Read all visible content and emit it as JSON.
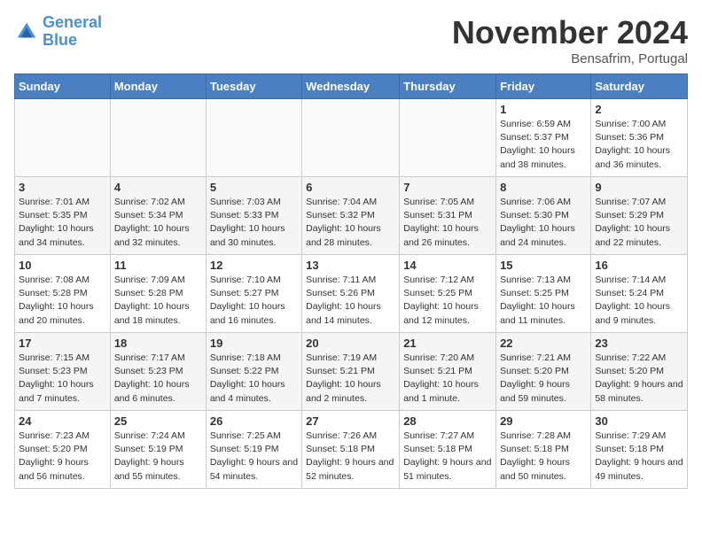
{
  "logo": {
    "line1": "General",
    "line2": "Blue"
  },
  "title": "November 2024",
  "location": "Bensafrim, Portugal",
  "headers": [
    "Sunday",
    "Monday",
    "Tuesday",
    "Wednesday",
    "Thursday",
    "Friday",
    "Saturday"
  ],
  "weeks": [
    [
      {
        "day": "",
        "sunrise": "",
        "sunset": "",
        "daylight": ""
      },
      {
        "day": "",
        "sunrise": "",
        "sunset": "",
        "daylight": ""
      },
      {
        "day": "",
        "sunrise": "",
        "sunset": "",
        "daylight": ""
      },
      {
        "day": "",
        "sunrise": "",
        "sunset": "",
        "daylight": ""
      },
      {
        "day": "",
        "sunrise": "",
        "sunset": "",
        "daylight": ""
      },
      {
        "day": "1",
        "sunrise": "Sunrise: 6:59 AM",
        "sunset": "Sunset: 5:37 PM",
        "daylight": "Daylight: 10 hours and 38 minutes."
      },
      {
        "day": "2",
        "sunrise": "Sunrise: 7:00 AM",
        "sunset": "Sunset: 5:36 PM",
        "daylight": "Daylight: 10 hours and 36 minutes."
      }
    ],
    [
      {
        "day": "3",
        "sunrise": "Sunrise: 7:01 AM",
        "sunset": "Sunset: 5:35 PM",
        "daylight": "Daylight: 10 hours and 34 minutes."
      },
      {
        "day": "4",
        "sunrise": "Sunrise: 7:02 AM",
        "sunset": "Sunset: 5:34 PM",
        "daylight": "Daylight: 10 hours and 32 minutes."
      },
      {
        "day": "5",
        "sunrise": "Sunrise: 7:03 AM",
        "sunset": "Sunset: 5:33 PM",
        "daylight": "Daylight: 10 hours and 30 minutes."
      },
      {
        "day": "6",
        "sunrise": "Sunrise: 7:04 AM",
        "sunset": "Sunset: 5:32 PM",
        "daylight": "Daylight: 10 hours and 28 minutes."
      },
      {
        "day": "7",
        "sunrise": "Sunrise: 7:05 AM",
        "sunset": "Sunset: 5:31 PM",
        "daylight": "Daylight: 10 hours and 26 minutes."
      },
      {
        "day": "8",
        "sunrise": "Sunrise: 7:06 AM",
        "sunset": "Sunset: 5:30 PM",
        "daylight": "Daylight: 10 hours and 24 minutes."
      },
      {
        "day": "9",
        "sunrise": "Sunrise: 7:07 AM",
        "sunset": "Sunset: 5:29 PM",
        "daylight": "Daylight: 10 hours and 22 minutes."
      }
    ],
    [
      {
        "day": "10",
        "sunrise": "Sunrise: 7:08 AM",
        "sunset": "Sunset: 5:28 PM",
        "daylight": "Daylight: 10 hours and 20 minutes."
      },
      {
        "day": "11",
        "sunrise": "Sunrise: 7:09 AM",
        "sunset": "Sunset: 5:28 PM",
        "daylight": "Daylight: 10 hours and 18 minutes."
      },
      {
        "day": "12",
        "sunrise": "Sunrise: 7:10 AM",
        "sunset": "Sunset: 5:27 PM",
        "daylight": "Daylight: 10 hours and 16 minutes."
      },
      {
        "day": "13",
        "sunrise": "Sunrise: 7:11 AM",
        "sunset": "Sunset: 5:26 PM",
        "daylight": "Daylight: 10 hours and 14 minutes."
      },
      {
        "day": "14",
        "sunrise": "Sunrise: 7:12 AM",
        "sunset": "Sunset: 5:25 PM",
        "daylight": "Daylight: 10 hours and 12 minutes."
      },
      {
        "day": "15",
        "sunrise": "Sunrise: 7:13 AM",
        "sunset": "Sunset: 5:25 PM",
        "daylight": "Daylight: 10 hours and 11 minutes."
      },
      {
        "day": "16",
        "sunrise": "Sunrise: 7:14 AM",
        "sunset": "Sunset: 5:24 PM",
        "daylight": "Daylight: 10 hours and 9 minutes."
      }
    ],
    [
      {
        "day": "17",
        "sunrise": "Sunrise: 7:15 AM",
        "sunset": "Sunset: 5:23 PM",
        "daylight": "Daylight: 10 hours and 7 minutes."
      },
      {
        "day": "18",
        "sunrise": "Sunrise: 7:17 AM",
        "sunset": "Sunset: 5:23 PM",
        "daylight": "Daylight: 10 hours and 6 minutes."
      },
      {
        "day": "19",
        "sunrise": "Sunrise: 7:18 AM",
        "sunset": "Sunset: 5:22 PM",
        "daylight": "Daylight: 10 hours and 4 minutes."
      },
      {
        "day": "20",
        "sunrise": "Sunrise: 7:19 AM",
        "sunset": "Sunset: 5:21 PM",
        "daylight": "Daylight: 10 hours and 2 minutes."
      },
      {
        "day": "21",
        "sunrise": "Sunrise: 7:20 AM",
        "sunset": "Sunset: 5:21 PM",
        "daylight": "Daylight: 10 hours and 1 minute."
      },
      {
        "day": "22",
        "sunrise": "Sunrise: 7:21 AM",
        "sunset": "Sunset: 5:20 PM",
        "daylight": "Daylight: 9 hours and 59 minutes."
      },
      {
        "day": "23",
        "sunrise": "Sunrise: 7:22 AM",
        "sunset": "Sunset: 5:20 PM",
        "daylight": "Daylight: 9 hours and 58 minutes."
      }
    ],
    [
      {
        "day": "24",
        "sunrise": "Sunrise: 7:23 AM",
        "sunset": "Sunset: 5:20 PM",
        "daylight": "Daylight: 9 hours and 56 minutes."
      },
      {
        "day": "25",
        "sunrise": "Sunrise: 7:24 AM",
        "sunset": "Sunset: 5:19 PM",
        "daylight": "Daylight: 9 hours and 55 minutes."
      },
      {
        "day": "26",
        "sunrise": "Sunrise: 7:25 AM",
        "sunset": "Sunset: 5:19 PM",
        "daylight": "Daylight: 9 hours and 54 minutes."
      },
      {
        "day": "27",
        "sunrise": "Sunrise: 7:26 AM",
        "sunset": "Sunset: 5:18 PM",
        "daylight": "Daylight: 9 hours and 52 minutes."
      },
      {
        "day": "28",
        "sunrise": "Sunrise: 7:27 AM",
        "sunset": "Sunset: 5:18 PM",
        "daylight": "Daylight: 9 hours and 51 minutes."
      },
      {
        "day": "29",
        "sunrise": "Sunrise: 7:28 AM",
        "sunset": "Sunset: 5:18 PM",
        "daylight": "Daylight: 9 hours and 50 minutes."
      },
      {
        "day": "30",
        "sunrise": "Sunrise: 7:29 AM",
        "sunset": "Sunset: 5:18 PM",
        "daylight": "Daylight: 9 hours and 49 minutes."
      }
    ]
  ]
}
